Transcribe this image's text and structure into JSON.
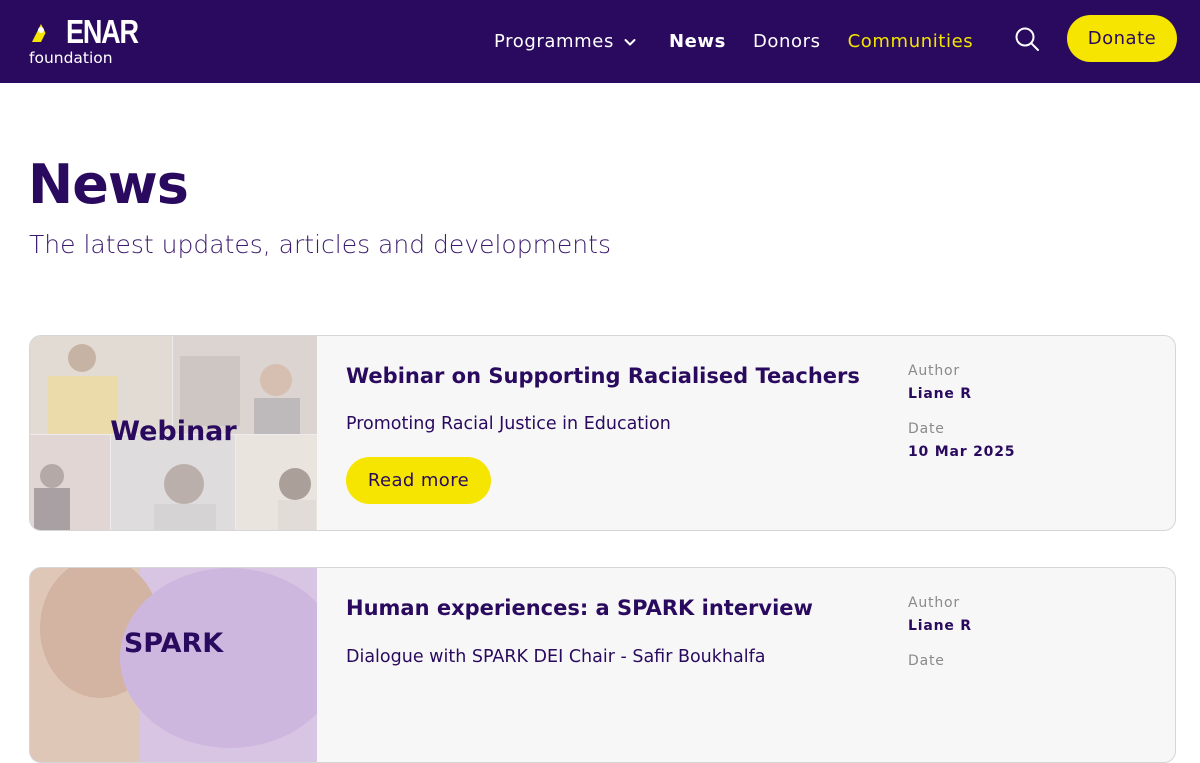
{
  "header": {
    "logo_text": "ENAR",
    "logo_subtext": "foundation",
    "nav": {
      "programmes": "Programmes",
      "news": "News",
      "donors": "Donors",
      "communities": "Communities"
    },
    "donate_label": "Donate",
    "colors": {
      "bg": "#2a0a5e",
      "accent": "#f5e500",
      "active_link": "#f2e500"
    }
  },
  "page": {
    "title": "News",
    "subtitle": "The latest updates, articles and developments"
  },
  "articles": [
    {
      "image_label": "Webinar",
      "title": "Webinar on Supporting Racialised Teachers",
      "description": "Promoting Racial Justice in Education",
      "read_more": "Read more",
      "author_label": "Author",
      "author": "Liane R",
      "date_label": "Date",
      "date": "10 Mar 2025"
    },
    {
      "image_label": "SPARK",
      "title": "Human experiences: a SPARK interview",
      "description": "Dialogue with SPARK DEI Chair - Safir Boukhalfa",
      "author_label": "Author",
      "author": "Liane R",
      "date_label": "Date"
    }
  ]
}
